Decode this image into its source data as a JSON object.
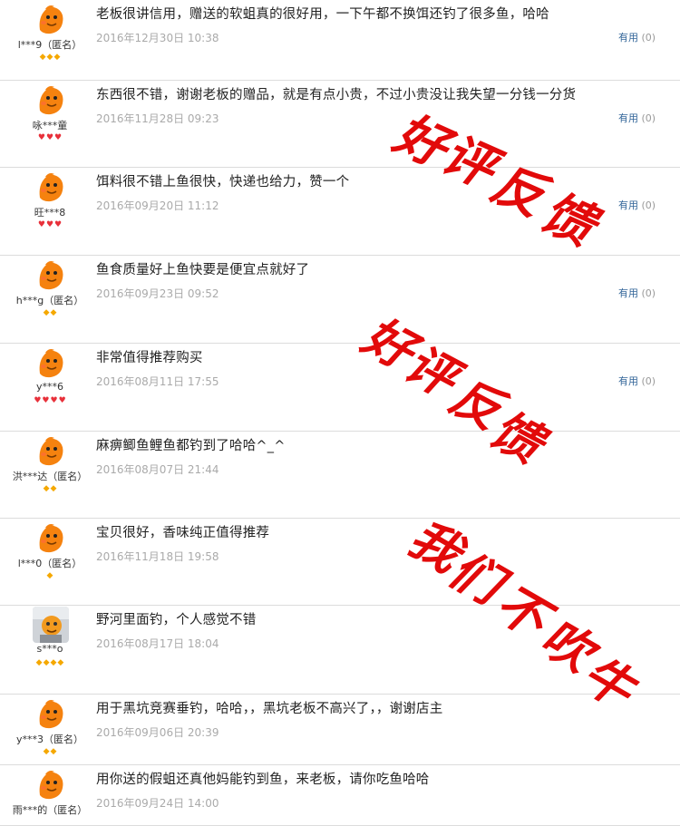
{
  "reviews": [
    {
      "avatar": "duck",
      "user": "l***9（匿名）",
      "badge_type": "gold",
      "badge_count": 3,
      "content": "老板很讲信用，赠送的软蛆真的很好用，一下午都不换饵还钓了很多鱼，哈哈",
      "date": "2016年12月30日 10:38",
      "useful_label": "有用",
      "useful_count": "(0)"
    },
    {
      "avatar": "duck",
      "user": "咏***童",
      "badge_type": "red",
      "badge_count": 3,
      "content": "东西很不错，谢谢老板的赠品，就是有点小贵，不过小贵没让我失望一分钱一分货",
      "date": "2016年11月28日 09:23",
      "useful_label": "有用",
      "useful_count": "(0)"
    },
    {
      "avatar": "duck",
      "user": "旺***8",
      "badge_type": "red",
      "badge_count": 3,
      "content": "饵料很不错上鱼很快，快递也给力，赞一个",
      "date": "2016年09月20日 11:12",
      "useful_label": "有用",
      "useful_count": "(0)"
    },
    {
      "avatar": "duck",
      "user": "h***g（匿名）",
      "badge_type": "gold",
      "badge_count": 2,
      "content": "鱼食质量好上鱼快要是便宜点就好了",
      "date": "2016年09月23日 09:52",
      "useful_label": "有用",
      "useful_count": "(0)"
    },
    {
      "avatar": "duck",
      "user": "y***6",
      "badge_type": "red",
      "badge_count": 4,
      "content": "非常值得推荐购买",
      "date": "2016年08月11日 17:55",
      "useful_label": "有用",
      "useful_count": "(0)"
    },
    {
      "avatar": "duck",
      "user": "洪***达（匿名）",
      "badge_type": "gold",
      "badge_count": 2,
      "content": "麻痹鲫鱼鲤鱼都钓到了哈哈^_^",
      "date": "2016年08月07日 21:44",
      "useful_label": "",
      "useful_count": ""
    },
    {
      "avatar": "duck",
      "user": "l***0（匿名）",
      "badge_type": "gold",
      "badge_count": 1,
      "content": "宝贝很好，香味纯正值得推荐",
      "date": "2016年11月18日 19:58",
      "useful_label": "",
      "useful_count": ""
    },
    {
      "avatar": "photo",
      "user": "s***o",
      "badge_type": "gold",
      "badge_count": 4,
      "content": "野河里面钓，个人感觉不错",
      "date": "2016年08月17日 18:04",
      "useful_label": "",
      "useful_count": ""
    },
    {
      "avatar": "duck",
      "user": "y***3（匿名）",
      "badge_type": "gold",
      "badge_count": 2,
      "content": "用于黑坑竞赛垂钓，哈哈，，黑坑老板不高兴了，，谢谢店主",
      "date": "2016年09月06日 20:39",
      "useful_label": "",
      "useful_count": ""
    },
    {
      "avatar": "duck",
      "user": "雨***的（匿名）",
      "badge_type": "gold",
      "badge_count": 0,
      "content": "用你送的假蛆还真他妈能钓到鱼，来老板，请你吃鱼哈哈",
      "date": "2016年09月24日 14:00",
      "useful_label": "",
      "useful_count": ""
    }
  ],
  "watermarks": [
    {
      "text": "好评反馈"
    },
    {
      "text": "好评反馈"
    },
    {
      "text": "我们不吹牛"
    }
  ],
  "colors": {
    "stamp": "#e20a0a",
    "badge_gold": "#f5a800",
    "badge_red": "#e8303a",
    "link": "#336699"
  }
}
